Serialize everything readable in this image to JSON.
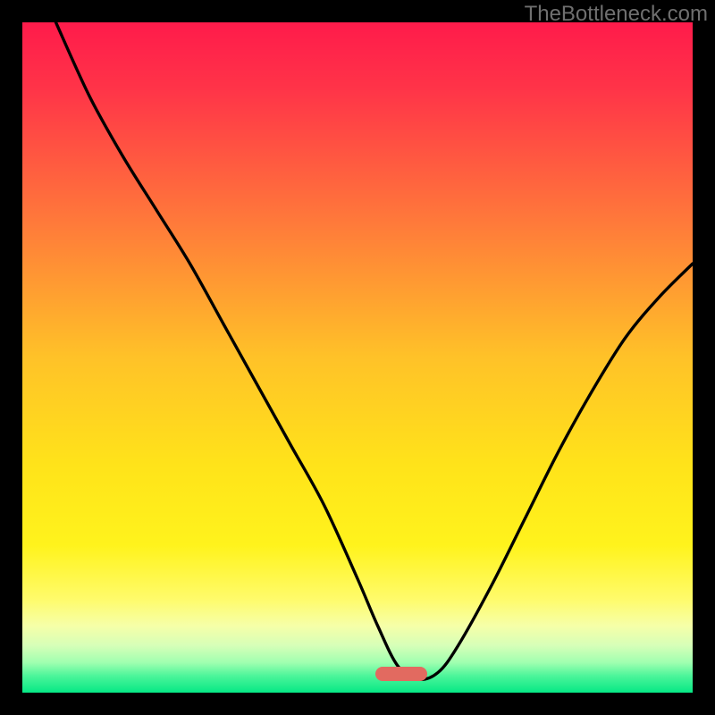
{
  "watermark": "TheBottleneck.com",
  "colors": {
    "frame": "#000000",
    "gradient_stops": [
      {
        "pos": 0.0,
        "color": "#ff1b4b"
      },
      {
        "pos": 0.1,
        "color": "#ff3448"
      },
      {
        "pos": 0.3,
        "color": "#ff7a3a"
      },
      {
        "pos": 0.5,
        "color": "#ffc228"
      },
      {
        "pos": 0.66,
        "color": "#ffe31a"
      },
      {
        "pos": 0.78,
        "color": "#fff31c"
      },
      {
        "pos": 0.86,
        "color": "#fffb6a"
      },
      {
        "pos": 0.9,
        "color": "#f6ffa8"
      },
      {
        "pos": 0.93,
        "color": "#d6ffb8"
      },
      {
        "pos": 0.955,
        "color": "#a0ffb0"
      },
      {
        "pos": 0.975,
        "color": "#4cf59a"
      },
      {
        "pos": 1.0,
        "color": "#06e885"
      }
    ],
    "curve": "#000000",
    "marker": "#e26a60"
  },
  "marker": {
    "x_frac": 0.565,
    "y_frac": 0.972,
    "w_frac": 0.078,
    "h_frac": 0.022
  },
  "chart_data": {
    "type": "line",
    "title": "",
    "xlabel": "",
    "ylabel": "",
    "xlim": [
      0,
      100
    ],
    "ylim": [
      0,
      100
    ],
    "series": [
      {
        "name": "bottleneck-curve",
        "x": [
          5,
          10,
          15,
          20,
          25,
          30,
          35,
          40,
          45,
          50,
          53,
          56,
          59,
          62,
          65,
          70,
          75,
          80,
          85,
          90,
          95,
          100
        ],
        "y": [
          100,
          89,
          80,
          72,
          64,
          55,
          46,
          37,
          28,
          17,
          10,
          4,
          2,
          3,
          7,
          16,
          26,
          36,
          45,
          53,
          59,
          64
        ]
      }
    ],
    "optimal_region": {
      "x_start": 55,
      "x_end": 62
    }
  }
}
